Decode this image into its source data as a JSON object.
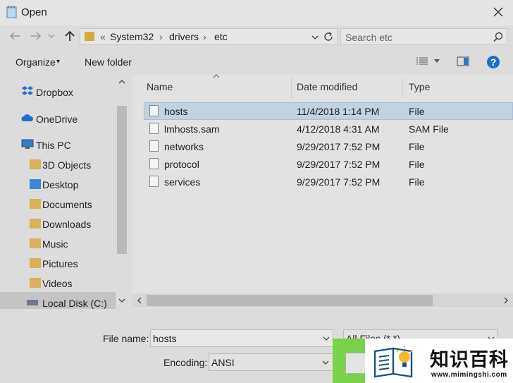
{
  "window": {
    "title": "Open"
  },
  "nav": {
    "path_overflow": "«",
    "path": [
      "System32",
      "drivers",
      "etc"
    ],
    "separator": "›",
    "search_placeholder": "Search etc"
  },
  "toolbar": {
    "organize": "Organize",
    "organize_caret": "▾",
    "new_folder": "New folder"
  },
  "sidebar": {
    "items": [
      {
        "label": "Dropbox",
        "icon": "dropbox-icon"
      },
      {
        "label": "OneDrive",
        "icon": "cloud-icon"
      },
      {
        "label": "This PC",
        "icon": "computer-icon"
      },
      {
        "label": "3D Objects",
        "icon": "folder-icon"
      },
      {
        "label": "Desktop",
        "icon": "folder-icon"
      },
      {
        "label": "Documents",
        "icon": "folder-icon"
      },
      {
        "label": "Downloads",
        "icon": "folder-icon"
      },
      {
        "label": "Music",
        "icon": "folder-icon"
      },
      {
        "label": "Pictures",
        "icon": "folder-icon"
      },
      {
        "label": "Videos",
        "icon": "folder-icon"
      },
      {
        "label": "Local Disk (C:)",
        "icon": "drive-icon"
      }
    ]
  },
  "files": {
    "columns": [
      "Name",
      "Date modified",
      "Type"
    ],
    "rows": [
      {
        "name": "hosts",
        "date": "11/4/2018 1:14 PM",
        "type": "File"
      },
      {
        "name": "lmhosts.sam",
        "date": "4/12/2018 4:31 AM",
        "type": "SAM File"
      },
      {
        "name": "networks",
        "date": "9/29/2017 7:52 PM",
        "type": "File"
      },
      {
        "name": "protocol",
        "date": "9/29/2017 7:52 PM",
        "type": "File"
      },
      {
        "name": "services",
        "date": "9/29/2017 7:52 PM",
        "type": "File"
      }
    ]
  },
  "footer": {
    "file_name_label": "File name:",
    "file_name_value": "hosts",
    "file_type_value": "All Files  (*.*)",
    "encoding_label": "Encoding:",
    "encoding_value": "ANSI"
  },
  "watermark": {
    "title": "知识百科",
    "url": "www.mimingshi.com"
  },
  "colors": {
    "selection": "#c3d2df",
    "help": "#1e6fc8",
    "watermark_green": "#7ad24b"
  }
}
